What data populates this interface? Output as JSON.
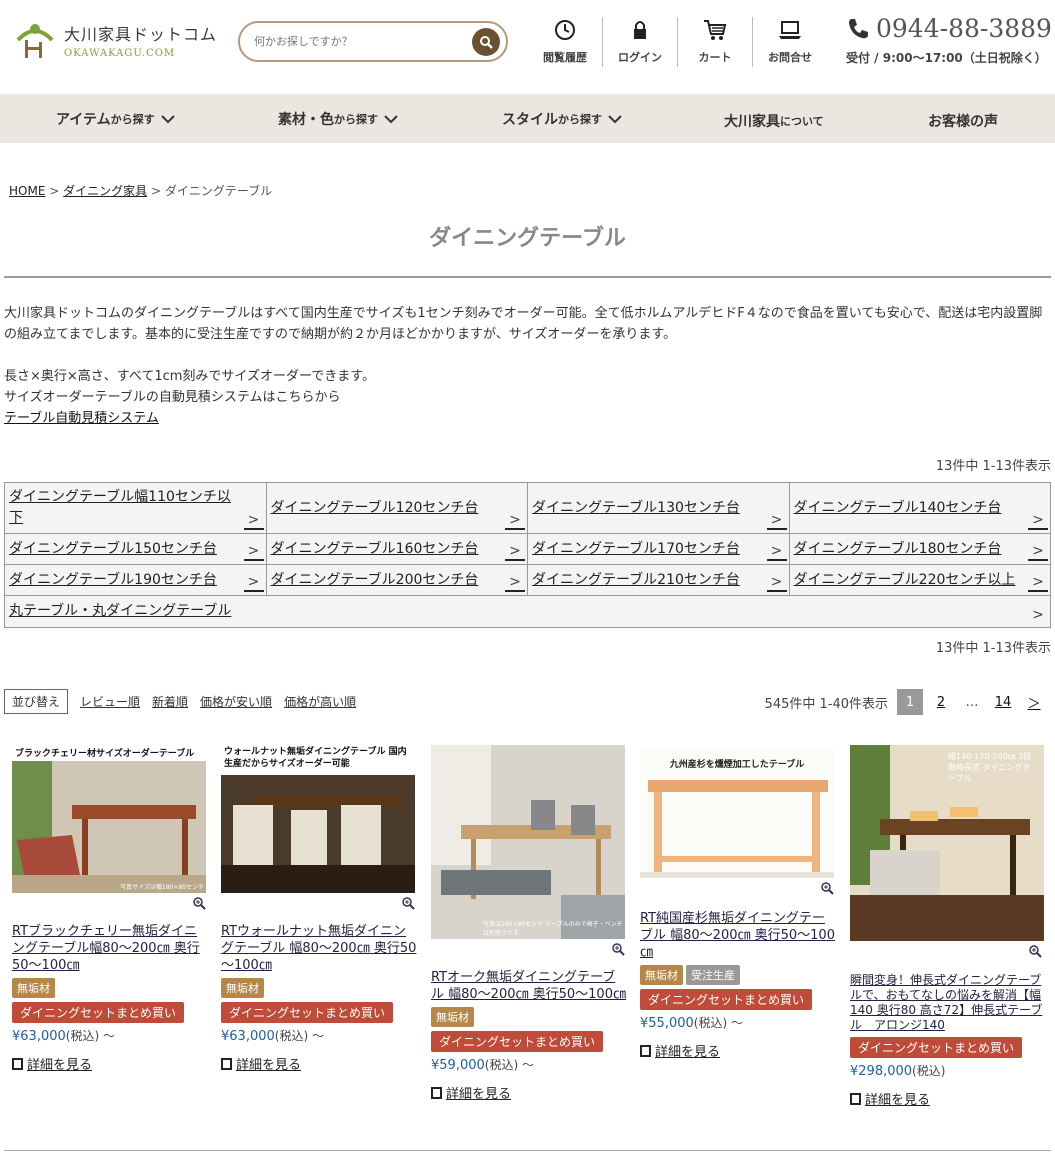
{
  "header": {
    "logo_jp": "大川家具ドットコム",
    "logo_en": "OKAWAKAGU.COM",
    "search_placeholder": "何かお探しですか？",
    "nav": [
      {
        "label": "閲覧履歴",
        "icon": "clock-icon"
      },
      {
        "label": "ログイン",
        "icon": "lock-icon"
      },
      {
        "label": "カート",
        "icon": "cart-icon"
      },
      {
        "label": "お問合せ",
        "icon": "laptop-icon"
      }
    ],
    "phone": "0944-88-3889",
    "hours": "受付 / 9:00～17:00（土日祝除く）"
  },
  "mainnav": [
    {
      "strong": "アイテム",
      "small": "から探す"
    },
    {
      "strong": "素材・色",
      "small": "から探す"
    },
    {
      "strong": "スタイル",
      "small": "から探す"
    },
    {
      "strong": "大川家具",
      "small": "について"
    },
    {
      "strong": "お客様の声",
      "small": ""
    }
  ],
  "breadcrumb": {
    "home": "HOME",
    "sep": ">",
    "level1": "ダイニング家具",
    "current": "ダイニングテーブル"
  },
  "page_title": "ダイニングテーブル",
  "intro": {
    "p1": "大川家具ドットコムのダイニングテーブルはすべて国内生産でサイズも1センチ刻みでオーダー可能。全て低ホルムアルデヒドF４なので食品を置いても安心で、配送は宅内設置脚の組み立てまでします。基本的に受注生産ですので納期が約２か月ほどかかりますが、サイズオーダーを承ります。",
    "p2_line1": "長さ×奥行×高さ、すべて1cm刻みでサイズオーダーできます。",
    "p2_line2": "サイズオーダーテーブルの自動見積システムはこちらから",
    "link": "テーブル自動見積システム"
  },
  "category_count": "13件中 1-13件表示",
  "categories": [
    [
      "ダイニングテーブル幅110センチ以下",
      "ダイニングテーブル120センチ台",
      "ダイニングテーブル130センチ台",
      "ダイニングテーブル140センチ台"
    ],
    [
      "ダイニングテーブル150センチ台",
      "ダイニングテーブル160センチ台",
      "ダイニングテーブル170センチ台",
      "ダイニングテーブル180センチ台"
    ],
    [
      "ダイニングテーブル190センチ台",
      "ダイニングテーブル200センチ台",
      "ダイニングテーブル210センチ台",
      "ダイニングテーブル220センチ以上"
    ],
    [
      "丸テーブル・丸ダイニングテーブル"
    ]
  ],
  "sort": {
    "label": "並び替え",
    "options": [
      "レビュー順",
      "新着順",
      "価格が安い順",
      "価格が高い順"
    ]
  },
  "pager": {
    "summary": "545件中 1-40件表示",
    "current": "1",
    "next_page": "2",
    "ellipsis": "…",
    "last": "14",
    "next": "＞"
  },
  "products": [
    {
      "img_caption": "ブラックチェリー材サイズオーダーテーブル",
      "img_note": "写真サイズは幅180×80センチ",
      "name": "RTブラックチェリー無垢ダイニングテーブル幅80～200㎝ 奥行50～100㎝",
      "badges": [
        "無垢材"
      ],
      "set": "ダイニングセットまとめ買い",
      "price": "¥63,000",
      "tax": "(税込) ～",
      "detail": "詳細を見る"
    },
    {
      "img_caption": "ウォールナット無垢ダイニングテーブル 国内生産だからサイズオーダー可能",
      "img_note": "",
      "name": "RTウォールナット無垢ダイニングテーブル 幅80～200㎝ 奥行50～100㎝",
      "badges": [
        "無垢材"
      ],
      "set": "ダイニングセットまとめ買い",
      "price": "¥63,000",
      "tax": "(税込) ～",
      "detail": "詳細を見る"
    },
    {
      "img_caption": "",
      "img_note": "写真は180×80センチ テーブルのみで椅子・ベンチは別売りです",
      "name": "RTオーク無垢ダイニングテーブル 幅80～200㎝ 奥行50～100㎝",
      "badges": [
        "無垢材"
      ],
      "set": "ダイニングセットまとめ買い",
      "price": "¥59,000",
      "tax": "(税込) ～",
      "detail": "詳細を見る"
    },
    {
      "img_caption": "九州産杉を燻煙加工したテーブル",
      "img_note": "",
      "name": "RT純国産杉無垢ダイニングテーブル 幅80～200㎝ 奥行50～100㎝",
      "badges": [
        "無垢材",
        "受注生産"
      ],
      "set": "ダイニングセットまとめ買い",
      "price": "¥55,000",
      "tax": "(税込) ～",
      "detail": "詳細を見る"
    },
    {
      "img_caption": "幅140-170-200㎝ 3段階伸長式 ダイニングテーブル",
      "img_note": "",
      "name": "瞬間変身！伸長式ダイニングテーブルで、おもてなしの悩みを解消【幅140 奥行80 高さ72】伸長式テーブル　アロンジ140",
      "badges": [],
      "set": "ダイニングセットまとめ買い",
      "price": "¥298,000",
      "tax": "(税込)",
      "detail": "詳細を見る"
    }
  ],
  "colors": {
    "accent_brown": "#6b5132",
    "nav_bg": "#ebe6df",
    "badge_wood": "#b5884a",
    "badge_set": "#c04b38",
    "price_blue": "#1c5fa8"
  }
}
